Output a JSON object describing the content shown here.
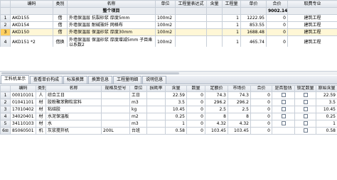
{
  "top_grid": {
    "headers": [
      "编码",
      "类别",
      "名称",
      "单位",
      "工程量表达式",
      "含量",
      "工程量",
      "单价",
      "合价",
      "取费专业"
    ],
    "group_row": {
      "code": "",
      "name": "整个项目",
      "total": "9002.14"
    },
    "rows": [
      {
        "num": "1",
        "code": "AKD155",
        "type": "借",
        "name": "外墙保温层 抗裂砂浆 厚度5mm",
        "unit": "100m2",
        "qty": "1",
        "price": "1222.95",
        "amount": "0",
        "specialty": "建筑工程"
      },
      {
        "num": "2",
        "code": "AKD154",
        "type": "借",
        "name": "外墙保温层 耐碱玻纤 网格布",
        "unit": "100m2",
        "qty": "1",
        "price": "853.55",
        "amount": "0",
        "specialty": "建筑工程"
      },
      {
        "num": "3",
        "code": "AKD150",
        "type": "借",
        "name": "外墙保温层 保温砂浆 厚度30mm",
        "unit": "100m2",
        "qty": "1",
        "price": "1688.48",
        "amount": "0",
        "specialty": "建筑工程"
      },
      {
        "num": "4",
        "code": "AKD151 *2",
        "type": "借换",
        "name": "外墙保温层 保温砂浆 厚度增减5mm 子目乘以系数2",
        "unit": "100m2",
        "qty": "1",
        "price": "465.74",
        "amount": "0",
        "specialty": "建筑工程"
      }
    ]
  },
  "tabs": [
    "工料机显示",
    "查看单价构成",
    "标准换算",
    "换算信息",
    "工程量明细",
    "说明信息"
  ],
  "active_tab": 0,
  "bottom_grid": {
    "headers": [
      "编码",
      "类别",
      "名称",
      "规格及型号",
      "单位",
      "损耗率",
      "含量",
      "数量",
      "定额价",
      "市场价",
      "合价",
      "是否暂估",
      "锁定数量",
      "原始含量"
    ],
    "rows": [
      {
        "num": "1",
        "code": "00010101",
        "type": "人",
        "name": "综合工日",
        "spec": "",
        "unit": "工日",
        "loss": "",
        "content": "22.59",
        "qty": "0",
        "quota": "74.3",
        "market": "74.3",
        "amount": "0",
        "est": false,
        "lock": false,
        "orig": "22.59"
      },
      {
        "num": "2",
        "code": "01041101",
        "type": "材",
        "name": "胶粉聚苯颗粒浆料",
        "spec": "",
        "unit": "m3",
        "loss": "",
        "content": "3.5",
        "qty": "0",
        "quota": "296.2",
        "market": "296.2",
        "amount": "0",
        "est": false,
        "lock": false,
        "orig": "3.5"
      },
      {
        "num": "3",
        "code": "17010402",
        "type": "材",
        "name": "粘结胶",
        "spec": "",
        "unit": "kg",
        "loss": "",
        "content": "10.45",
        "qty": "0",
        "quota": "2.5",
        "market": "2.5",
        "amount": "0",
        "est": false,
        "lock": false,
        "orig": "10.45"
      },
      {
        "num": "4",
        "code": "34020401",
        "type": "材",
        "name": "水泥保温板",
        "spec": "",
        "unit": "m2",
        "loss": "",
        "content": "0.25",
        "qty": "0",
        "quota": "8",
        "market": "8",
        "amount": "0",
        "est": false,
        "lock": false,
        "orig": "0.25"
      },
      {
        "num": "5",
        "code": "34110103",
        "type": "材",
        "name": "水",
        "spec": "",
        "unit": "m3",
        "loss": "",
        "content": "1",
        "qty": "0",
        "quota": "4.32",
        "market": "4.32",
        "amount": "0",
        "est": false,
        "lock": false,
        "orig": "1"
      },
      {
        "num": "6",
        "code": "85060501",
        "type": "机",
        "name": "灰浆搅拌机",
        "spec": "200L",
        "unit": "台班",
        "loss": "",
        "content": "0.58",
        "qty": "0",
        "quota": "103.45",
        "market": "103.45",
        "amount": "0",
        "est": false,
        "lock": false,
        "orig": "0.58"
      }
    ]
  },
  "colors": {
    "header_bg": "#dfe4ea",
    "selected_row": "#fff7d6",
    "selected_marker": "#ffcf60",
    "grid_line": "#c8cfd8"
  }
}
